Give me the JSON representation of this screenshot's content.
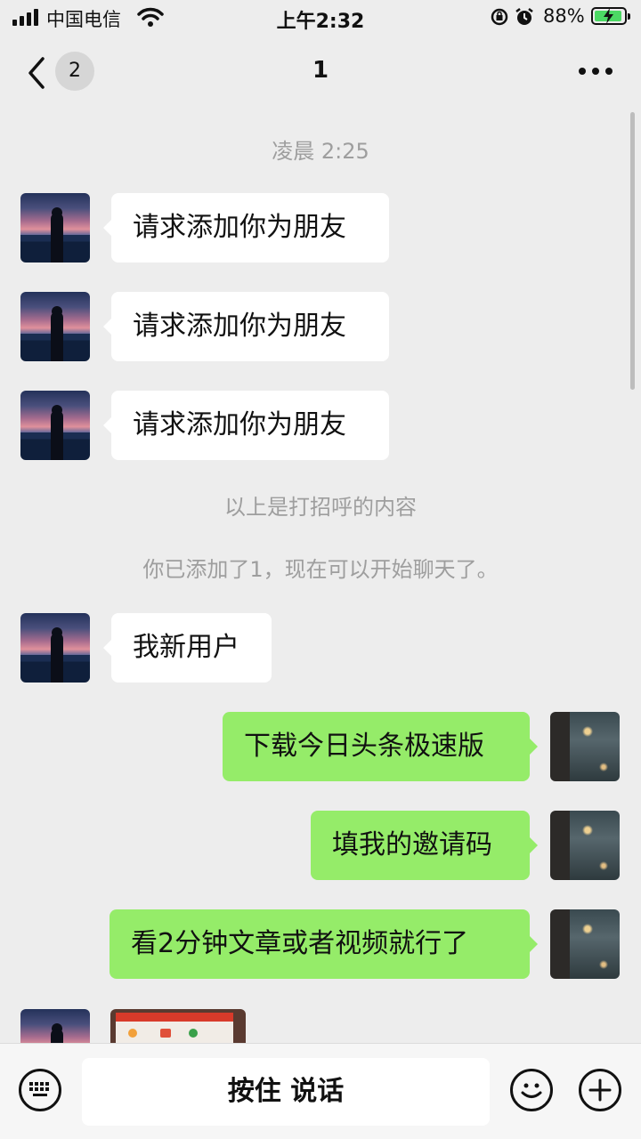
{
  "status_bar": {
    "carrier": "中国电信",
    "time": "上午2:32",
    "battery": "88%",
    "battery_level": 0.88
  },
  "nav": {
    "unread_count": "2",
    "title": "1"
  },
  "chat": {
    "timestamp": "凌晨 2:25",
    "greeting_messages": [
      "请求添加你为朋友",
      "请求添加你为朋友",
      "请求添加你为朋友"
    ],
    "greeting_note": "以上是打招呼的内容",
    "added_note": "你已添加了1，现在可以开始聊天了。",
    "received": "我新用户",
    "sent": [
      "下载今日头条极速版",
      "填我的邀请码",
      "看2分钟文章或者视频就行了"
    ]
  },
  "input_bar": {
    "hold_to_talk": "按住 说话"
  },
  "icons": [
    "signal-icon",
    "wifi-icon",
    "lock-rotation-icon",
    "alarm-icon",
    "battery-icon",
    "back-icon",
    "more-icon",
    "keyboard-icon",
    "emoji-icon",
    "plus-icon"
  ],
  "colors": {
    "background": "#ededed",
    "sent_bubble": "#95ec69",
    "received_bubble": "#ffffff",
    "system_text": "#9e9e9e"
  }
}
